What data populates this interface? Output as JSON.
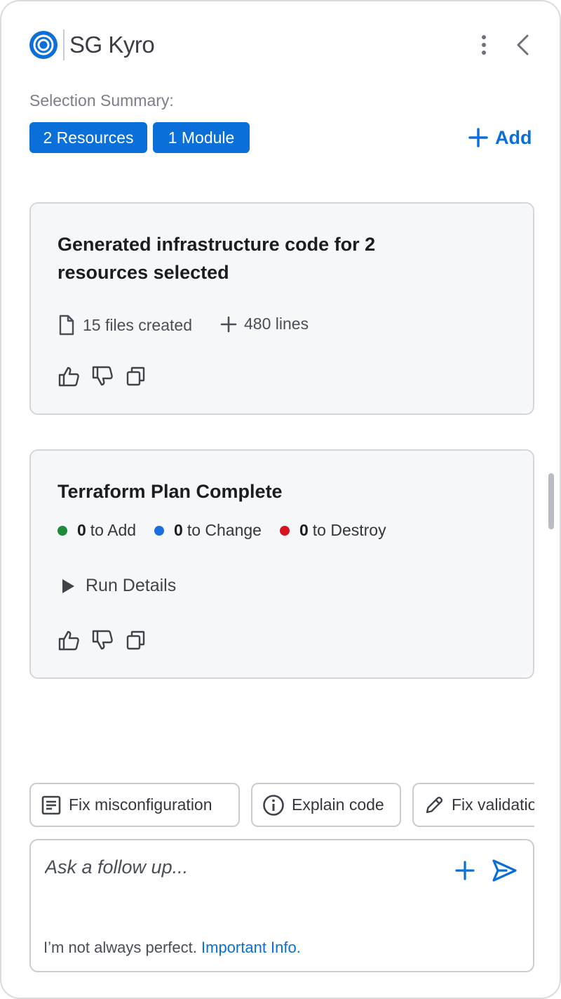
{
  "app": {
    "title": "SG Kyro"
  },
  "selection": {
    "label": "Selection Summary:",
    "chips": [
      "2 Resources",
      "1 Module"
    ],
    "add_label": "Add"
  },
  "cards": [
    {
      "title": "Generated infrastructure code for 2 resources selected",
      "files": "15 files created",
      "lines": "480 lines"
    },
    {
      "title": "Terraform Plan Complete",
      "plan": [
        {
          "count": "0",
          "label": "to Add",
          "color": "#1f8a3a"
        },
        {
          "count": "0",
          "label": "to Change",
          "color": "#1a6fe0"
        },
        {
          "count": "0",
          "label": "to Destroy",
          "color": "#d8121f"
        }
      ],
      "run_details": "Run Details"
    }
  ],
  "suggestions": [
    "Fix misconfiguration",
    "Explain code",
    "Fix validation"
  ],
  "input": {
    "placeholder": "Ask a follow up...",
    "disclaimer_prefix": "I’m not always perfect.",
    "disclaimer_link": "Important Info."
  },
  "colors": {
    "accent": "#0a6fd8"
  }
}
